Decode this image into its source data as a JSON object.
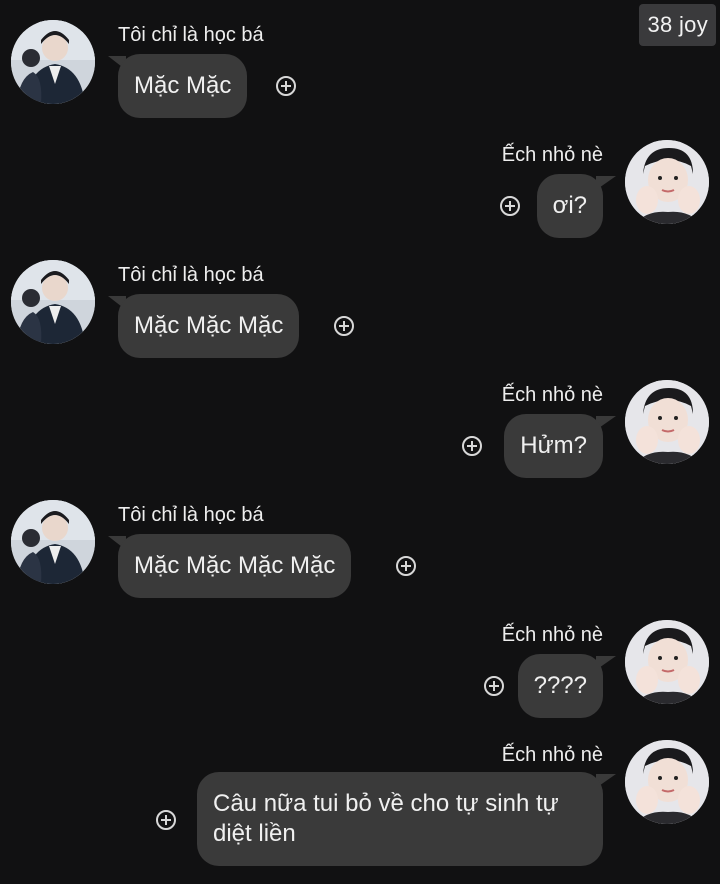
{
  "header": {
    "badge": "38 joy"
  },
  "participants": {
    "left_name": "Tôi chỉ là học bá",
    "right_name": "Ếch nhỏ nè"
  },
  "messages": [
    {
      "side": "left",
      "sender": "Tôi chỉ là học bá",
      "text": "Mặc Mặc"
    },
    {
      "side": "right",
      "sender": "Ếch nhỏ nè",
      "text": "ơi?"
    },
    {
      "side": "left",
      "sender": "Tôi chỉ là học bá",
      "text": "Mặc Mặc Mặc"
    },
    {
      "side": "right",
      "sender": "Ếch nhỏ nè",
      "text": "Hửm?"
    },
    {
      "side": "left",
      "sender": "Tôi chỉ là học bá",
      "text": "Mặc Mặc Mặc Mặc"
    },
    {
      "side": "right",
      "sender": "Ếch nhỏ nè",
      "text": "????"
    },
    {
      "side": "right",
      "sender": "Ếch nhỏ nè",
      "text": "Câu nữa tui bỏ về cho tự sinh tự diệt liền"
    }
  ],
  "colors": {
    "background": "#111112",
    "bubble": "#3a3a3a",
    "badge": "#3a3a3c",
    "text": "#f0f0f0"
  },
  "icons": {
    "add_reaction": "plus-circle-icon",
    "left_avatar": "avatar-boy-in-blazer",
    "right_avatar": "avatar-boy-hands-on-cheeks"
  }
}
